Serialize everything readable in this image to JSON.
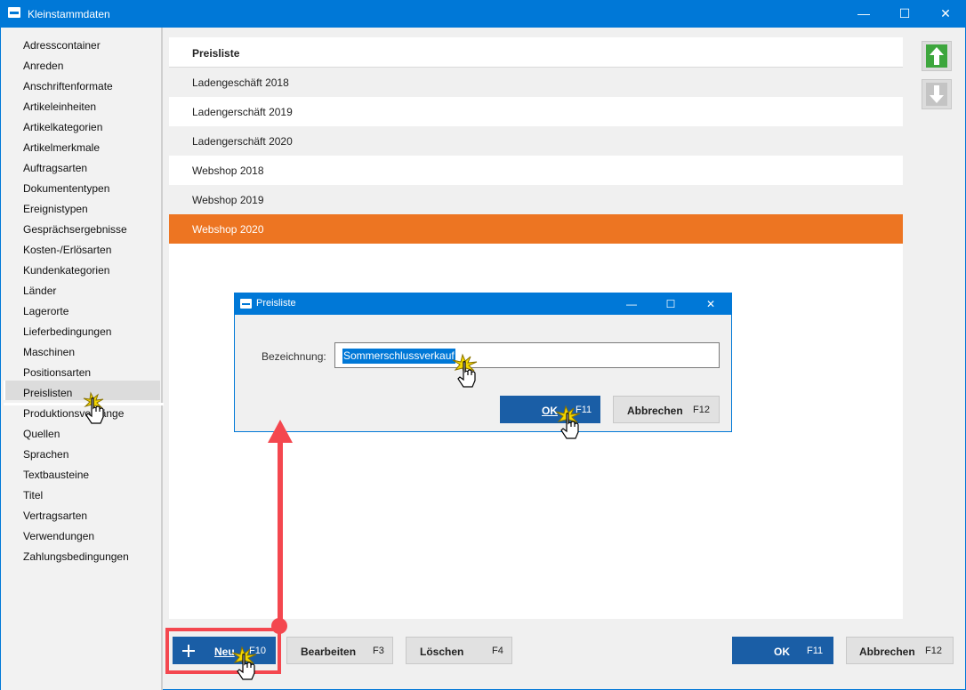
{
  "window": {
    "title": "Kleinstammdaten",
    "controls": [
      "—",
      "☐",
      "✕"
    ]
  },
  "sidebar": {
    "items": [
      "Adresscontainer",
      "Anreden",
      "Anschriftenformate",
      "Artikeleinheiten",
      "Artikelkategorien",
      "Artikelmerkmale",
      "Auftragsarten",
      "Dokumententypen",
      "Ereignistypen",
      "Gesprächsergebnisse",
      "Kosten-/Erlösarten",
      "Kundenkategorien",
      "Länder",
      "Lagerorte",
      "Lieferbedingungen",
      "Maschinen",
      "Positionsarten",
      "Preislisten",
      "Produktionsvorgänge",
      "Quellen",
      "Sprachen",
      "Textbausteine",
      "Titel",
      "Vertragsarten",
      "Verwendungen",
      "Zahlungsbedingungen"
    ],
    "selected": "Preislisten"
  },
  "grid": {
    "header": "Preisliste",
    "rows": [
      "Ladengeschäft 2018",
      "Ladengerschäft 2019",
      "Ladengerschäft 2020",
      "Webshop 2018",
      "Webshop 2019",
      "Webshop 2020"
    ],
    "selected_row": "Webshop 2020"
  },
  "toolbar": {
    "new_label": "Neu",
    "new_key": "F10",
    "edit_label": "Bearbeiten",
    "edit_key": "F3",
    "delete_label": "Löschen",
    "delete_key": "F4",
    "ok_label": "OK",
    "ok_key": "F11",
    "cancel_label": "Abbrechen",
    "cancel_key": "F12"
  },
  "dialog": {
    "title": "Preisliste",
    "field_label": "Bezeichnung:",
    "field_value": "Sommerschlussverkauf",
    "ok_label": "OK",
    "ok_key": "F11",
    "cancel_label": "Abbrechen",
    "cancel_key": "F12"
  },
  "colors": {
    "titlebar": "#0078d7",
    "selection": "#ed7522",
    "primary_button": "#1a5ea6",
    "annotation": "#f4474f",
    "up_arrow": "#3da63d"
  },
  "icons": [
    "app-icon",
    "arrow-up-icon",
    "arrow-down-icon",
    "plus-icon",
    "hand-cursor-icon"
  ]
}
